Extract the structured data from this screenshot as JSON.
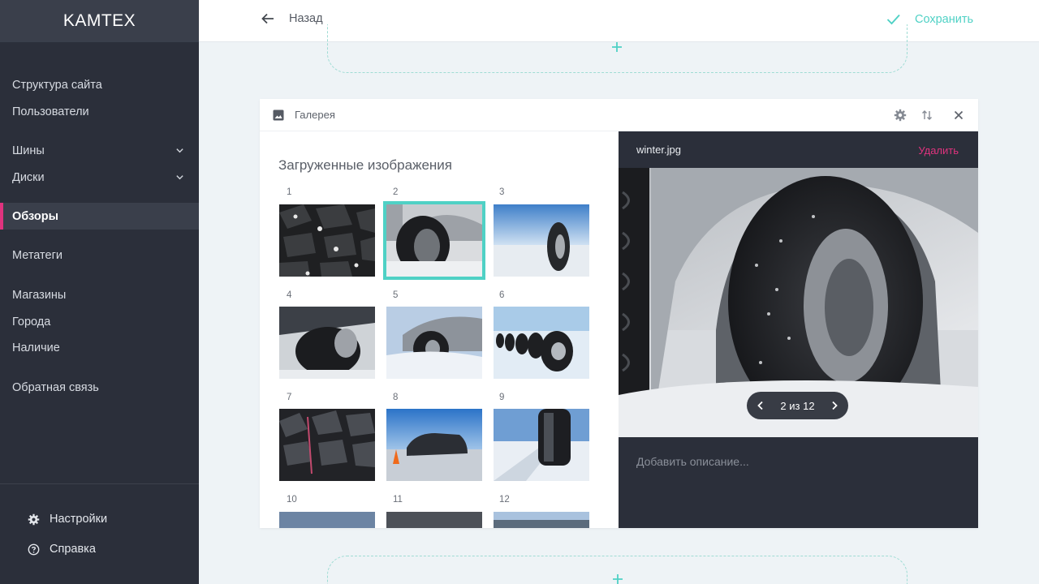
{
  "app": {
    "brand": "KAMTEX"
  },
  "topbar": {
    "back_label": "Назад",
    "save_label": "Сохранить"
  },
  "sidebar": {
    "items": [
      {
        "label": "Структура сайта",
        "has_children": false,
        "active": false
      },
      {
        "label": "Пользователи",
        "has_children": false,
        "active": false
      },
      {
        "label": "Шины",
        "has_children": true,
        "active": false
      },
      {
        "label": "Диски",
        "has_children": true,
        "active": false
      },
      {
        "label": "Обзоры",
        "has_children": false,
        "active": true
      },
      {
        "label": "Метатеги",
        "has_children": false,
        "active": false
      },
      {
        "label": "Магазины",
        "has_children": false,
        "active": false
      },
      {
        "label": "Города",
        "has_children": false,
        "active": false
      },
      {
        "label": "Наличие",
        "has_children": false,
        "active": false
      },
      {
        "label": "Обратная связь",
        "has_children": false,
        "active": false
      }
    ],
    "bottom": {
      "settings_label": "Настройки",
      "help_label": "Справка"
    }
  },
  "gallery": {
    "title": "Галерея",
    "section_title": "Загруженные изображения",
    "selected_index": 2,
    "thumbnails": [
      "1",
      "2",
      "3",
      "4",
      "5",
      "6",
      "7",
      "8",
      "9",
      "10",
      "11",
      "12"
    ],
    "preview": {
      "filename": "winter.jpg",
      "delete_label": "Удалить",
      "pager": "2 из 12",
      "description_placeholder": "Добавить описание..."
    }
  },
  "colors": {
    "accent": "#4fd1c5",
    "active_marker": "#e0337e",
    "sidebar_bg": "#2b2f3a",
    "delete": "#e0337e"
  }
}
